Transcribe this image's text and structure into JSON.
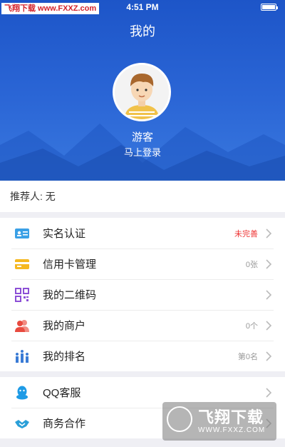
{
  "status_bar": {
    "watermark": "飞翔下载 www.FXXZ.com",
    "time": "4:51 PM"
  },
  "header": {
    "title": "我的"
  },
  "profile": {
    "username": "游客",
    "login_prompt": "马上登录"
  },
  "referrer": {
    "text": "推荐人: 无"
  },
  "menu_group_1": [
    {
      "label": "实名认证",
      "value": "未完善",
      "icon": "id-card-icon"
    },
    {
      "label": "信用卡管理",
      "value": "0张",
      "icon": "credit-card-icon"
    },
    {
      "label": "我的二维码",
      "value": "",
      "icon": "qr-code-icon"
    },
    {
      "label": "我的商户",
      "value": "0个",
      "icon": "merchant-icon"
    },
    {
      "label": "我的排名",
      "value": "第0名",
      "icon": "ranking-icon"
    }
  ],
  "menu_group_2": [
    {
      "label": "QQ客服",
      "icon": "qq-icon"
    },
    {
      "label": "商务合作",
      "icon": "handshake-icon"
    }
  ],
  "watermark_bottom": {
    "name": "飞翔下载",
    "url": "WWW.FXXZ.COM"
  },
  "colors": {
    "header_blue": "#2b66d6",
    "warn_red": "#e33333"
  }
}
